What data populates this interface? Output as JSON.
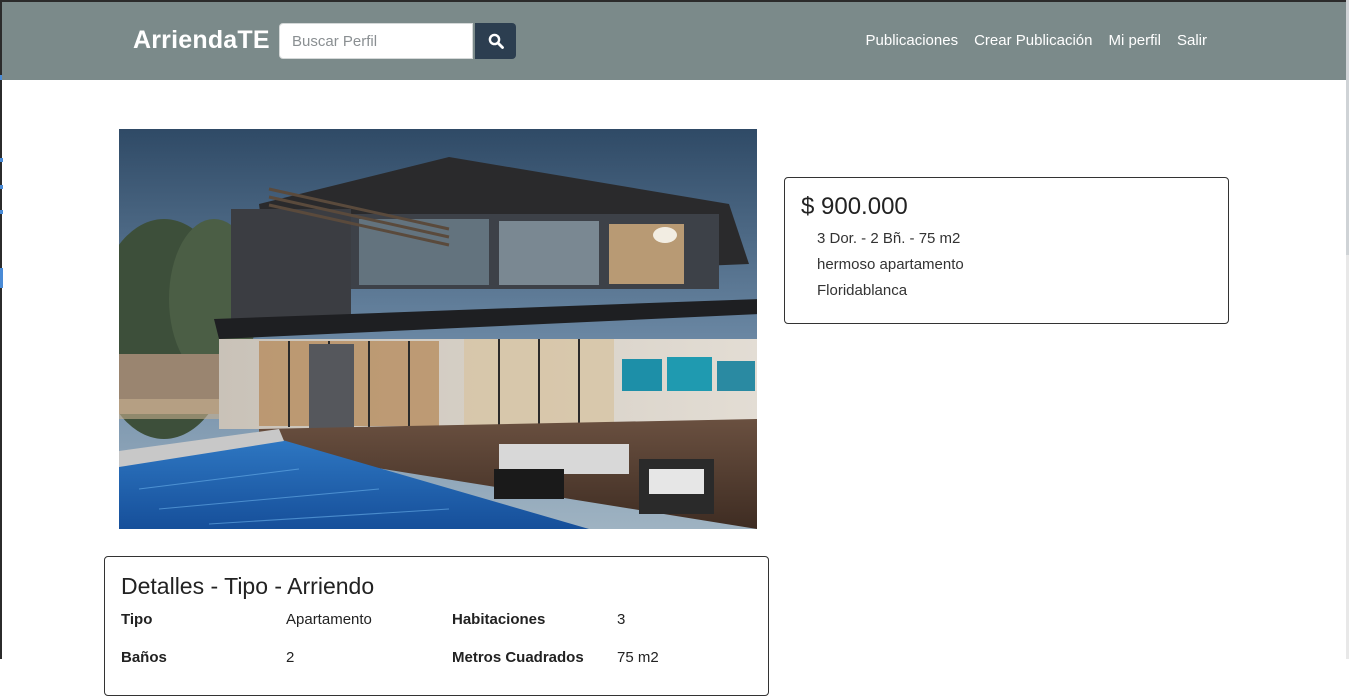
{
  "navbar": {
    "brand": "ArriendaTE",
    "search": {
      "placeholder": "Buscar Perfil",
      "value": ""
    },
    "links": [
      "Publicaciones",
      "Crear Publicación",
      "Mi perfil",
      "Salir"
    ]
  },
  "listing": {
    "price": "$ 900.000",
    "summary": "3 Dor. - 2 Bñ. - 75 m2",
    "description": "hermoso apartamento",
    "location": "Floridablanca"
  },
  "details": {
    "title": "Detalles - Tipo - Arriendo",
    "rows": [
      {
        "label1": "Tipo",
        "value1": "Apartamento",
        "label2": "Habitaciones",
        "value2": "3"
      },
      {
        "label1": "Baños",
        "value1": "2",
        "label2": "Metros Cuadrados",
        "value2": "75 m2"
      }
    ]
  },
  "colors": {
    "navbar_bg": "#7b8a8a",
    "search_button_bg": "#2c3e50"
  },
  "icons": {
    "search": "search-icon"
  }
}
